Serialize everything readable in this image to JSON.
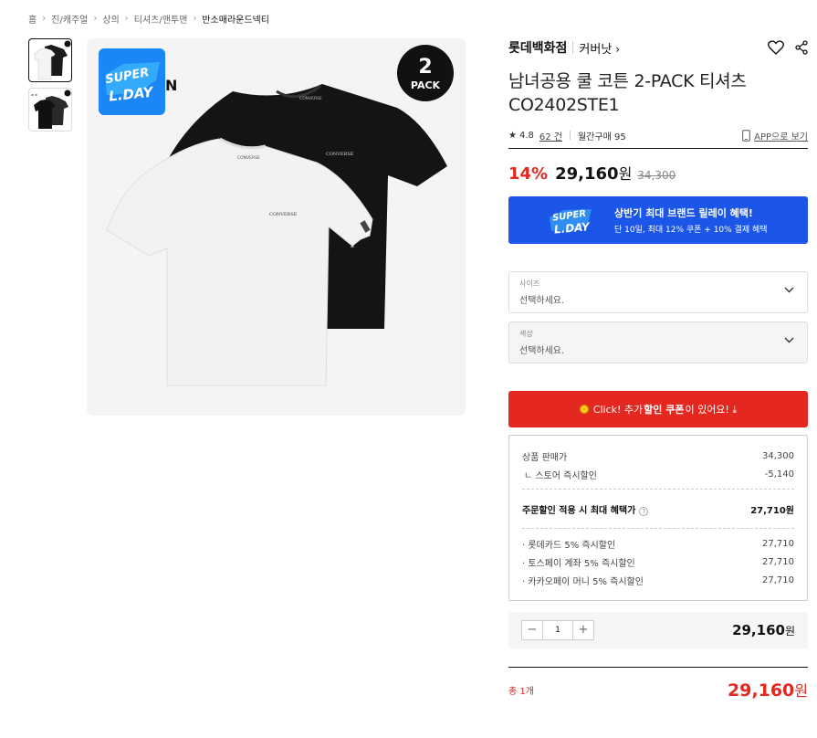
{
  "breadcrumb": [
    "홈",
    "진/캐주얼",
    "상의",
    "티셔츠/맨투맨",
    "반소매라운드넥티"
  ],
  "gallery": {
    "badge_number": "2",
    "badge_text": "PACK",
    "logo_line1": "SUPER",
    "logo_line2": "L.DAY",
    "letter_fragment": "N",
    "tshirt_print": "CONVERSE"
  },
  "product": {
    "brand": "롯데백화점",
    "sub_brand": "커버낫",
    "title_line1": "남녀공용 쿨 코튼 2-PACK 티셔츠",
    "title_line2": "CO2402STE1",
    "rating": "4.8",
    "reviews": "62 건",
    "monthly": "월간구매 95",
    "app_link": "APP으로 보기"
  },
  "price": {
    "discount": "14%",
    "amount": "29,160",
    "won": "원",
    "original": "34,300"
  },
  "banner": {
    "title": "상반기 최대 브랜드 릴레이 혜택!",
    "sub": "단 10일, 최대 12% 쿠폰 + 10% 결제 혜택"
  },
  "options": [
    {
      "label": "사이즈",
      "value": "선택하세요."
    },
    {
      "label": "색상",
      "value": "선택하세요."
    }
  ],
  "coupon": {
    "pre": "Click! 추가 ",
    "bold": "할인 쿠폰",
    "post": "이 있어요! ⤓"
  },
  "breakdown": {
    "rows": [
      {
        "label": "상품 판매가",
        "value": "34,300"
      },
      {
        "label": "ㄴ 스토어 즉시할인",
        "value": "-5,140"
      }
    ],
    "max_label": "주문할인 적용 시 최대 혜택가",
    "max_value": "27,710원",
    "cards": [
      {
        "label": "· 롯데카드 5% 즉시할인",
        "value": "27,710"
      },
      {
        "label": "· 토스페이 계좌 5% 즉시할인",
        "value": "27,710"
      },
      {
        "label": "· 카카오페이 머니 5% 즉시할인",
        "value": "27,710"
      }
    ]
  },
  "quantity": {
    "minus": "−",
    "value": "1",
    "plus": "+",
    "price": "29,160",
    "won": "원"
  },
  "total": {
    "label": "총 1개",
    "price": "29,160",
    "won": "원"
  },
  "colors": {
    "accent_red": "#e4281f",
    "banner_blue": "#1b56e8"
  }
}
